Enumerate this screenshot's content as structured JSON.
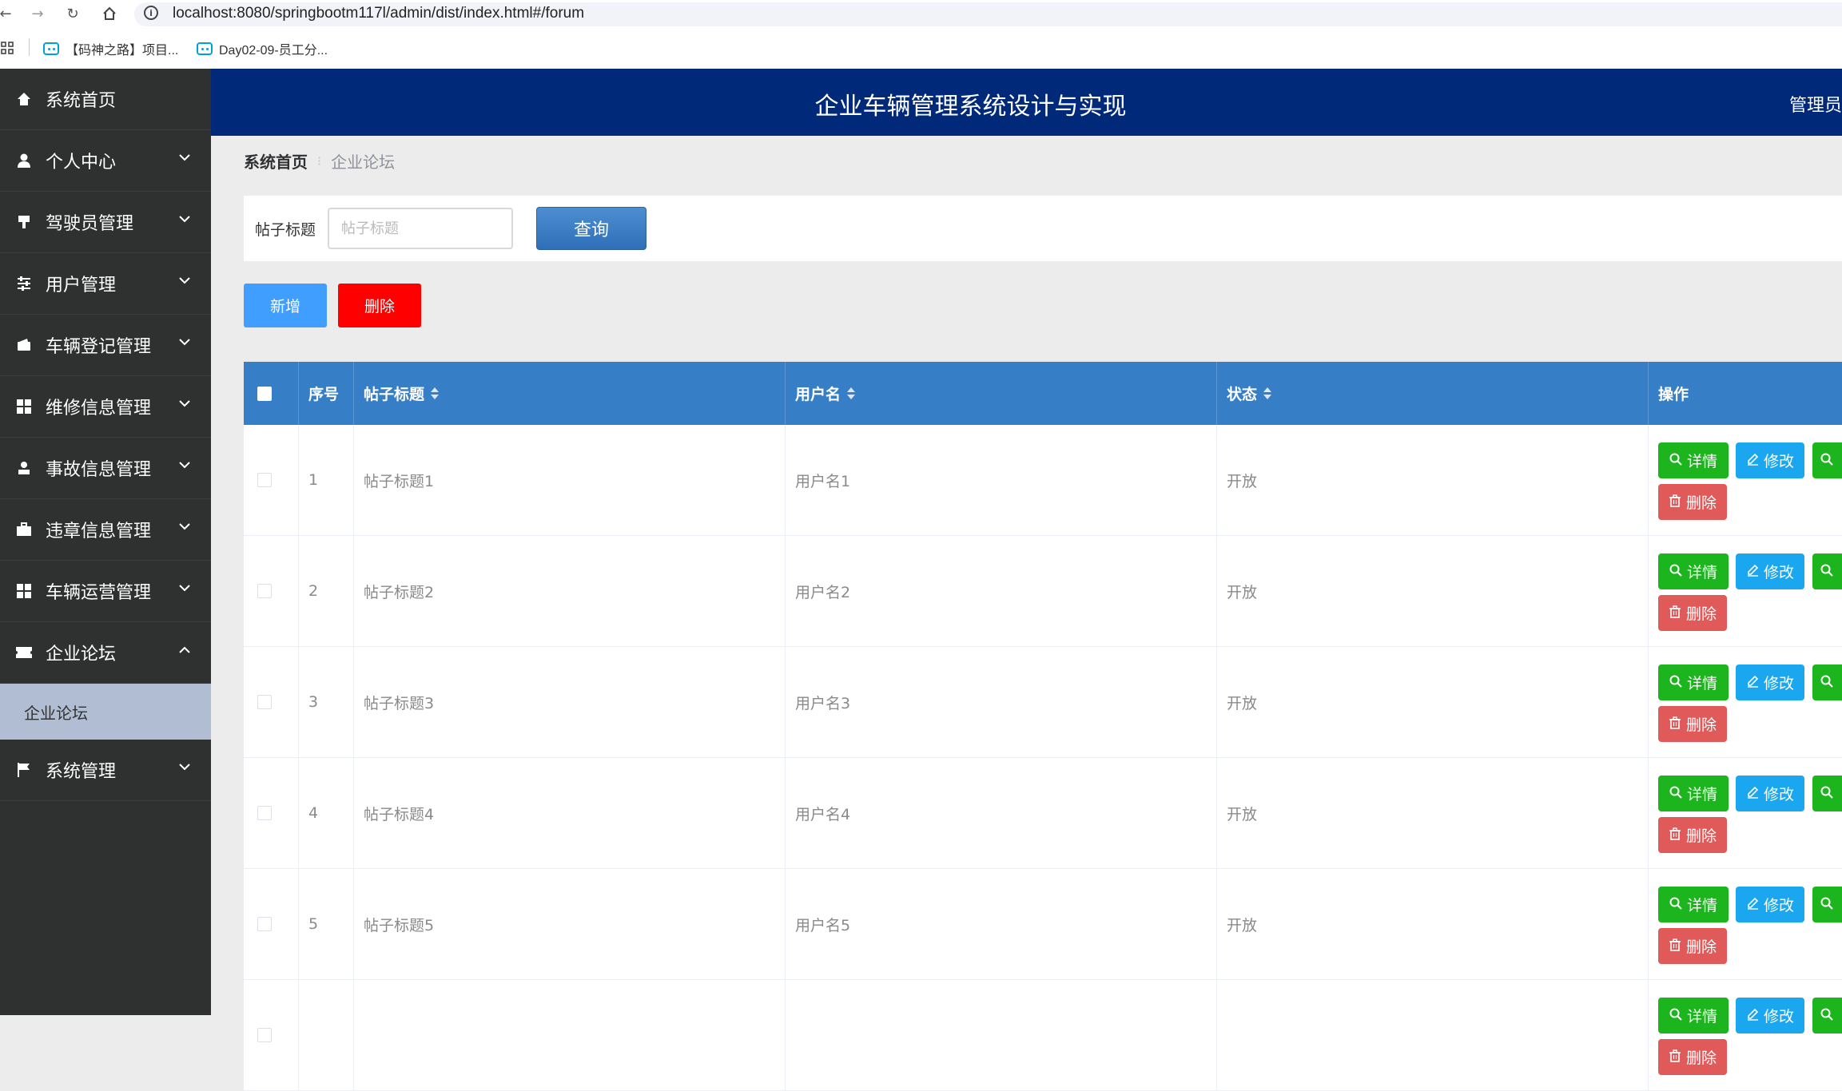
{
  "browser": {
    "url": "localhost:8080/springbootm117l/admin/dist/index.html#/forum",
    "bookmarks": [
      "【码神之路】项目...",
      "Day02-09-员工分..."
    ]
  },
  "header": {
    "title": "企业车辆管理系统设计与实现",
    "user": "管理员"
  },
  "sidebar": {
    "items": [
      {
        "label": "系统首页",
        "icon": "home-icon",
        "expandable": false
      },
      {
        "label": "个人中心",
        "icon": "person-icon",
        "expandable": true
      },
      {
        "label": "驾驶员管理",
        "icon": "brush-icon",
        "expandable": true
      },
      {
        "label": "用户管理",
        "icon": "sliders-icon",
        "expandable": true
      },
      {
        "label": "车辆登记管理",
        "icon": "wallet-icon",
        "expandable": true
      },
      {
        "label": "维修信息管理",
        "icon": "grid-icon",
        "expandable": true
      },
      {
        "label": "事故信息管理",
        "icon": "user-stand-icon",
        "expandable": true
      },
      {
        "label": "违章信息管理",
        "icon": "briefcase-icon",
        "expandable": true
      },
      {
        "label": "车辆运营管理",
        "icon": "grid-icon",
        "expandable": true
      },
      {
        "label": "企业论坛",
        "icon": "ticket-icon",
        "expandable": true,
        "expanded": true
      },
      {
        "label": "系统管理",
        "icon": "flag-icon",
        "expandable": true
      }
    ],
    "submenu": {
      "label": "企业论坛"
    }
  },
  "breadcrumb": {
    "home": "系统首页",
    "separator": "⁝",
    "current": "企业论坛"
  },
  "search": {
    "label": "帖子标题",
    "placeholder": "帖子标题",
    "button": "查询"
  },
  "actions": {
    "add": "新增",
    "delete": "删除"
  },
  "table": {
    "columns": [
      "序号",
      "帖子标题",
      "用户名",
      "状态",
      "操作"
    ],
    "rows": [
      {
        "no": "1",
        "title": "帖子标题1",
        "user": "用户名1",
        "status": "开放"
      },
      {
        "no": "2",
        "title": "帖子标题2",
        "user": "用户名2",
        "status": "开放"
      },
      {
        "no": "3",
        "title": "帖子标题3",
        "user": "用户名3",
        "status": "开放"
      },
      {
        "no": "4",
        "title": "帖子标题4",
        "user": "用户名4",
        "status": "开放"
      },
      {
        "no": "5",
        "title": "帖子标题5",
        "user": "用户名5",
        "status": "开放"
      },
      {
        "no": "",
        "title": "",
        "user": "",
        "status": ""
      }
    ],
    "row_actions": {
      "detail": "详情",
      "edit": "修改",
      "remove": "删除"
    }
  },
  "colors": {
    "header_bg": "#00297a",
    "sidebar_bg": "#2f3030",
    "table_header_bg": "#367fc7",
    "submenu_bg": "#b1bdd2",
    "add_button": "#409eff",
    "delete_button": "#ff0000",
    "detail_button": "#1db51d",
    "edit_button": "#1aa7ef",
    "remove_button": "#e05a5a"
  }
}
